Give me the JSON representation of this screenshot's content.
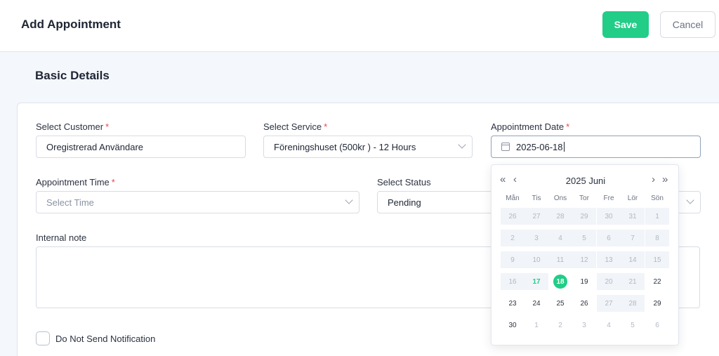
{
  "header": {
    "title": "Add Appointment",
    "save_label": "Save",
    "cancel_label": "Cancel"
  },
  "section": {
    "title": "Basic Details"
  },
  "form": {
    "customer": {
      "label": "Select Customer",
      "required": "*",
      "value": "Oregistrerad Användare"
    },
    "service": {
      "label": "Select Service",
      "required": "*",
      "value": "Föreningshuset (500kr ) - 12 Hours"
    },
    "date": {
      "label": "Appointment Date",
      "required": "*",
      "value": "2025-06-18"
    },
    "time": {
      "label": "Appointment Time",
      "required": "*",
      "placeholder": "Select Time"
    },
    "status": {
      "label": "Select Status",
      "value": "Pending"
    },
    "note": {
      "label": "Internal note"
    },
    "notify": {
      "label": "Do Not Send Notification",
      "checked": false
    }
  },
  "calendar": {
    "title": "2025 Juni",
    "prev_year": "«",
    "prev_month": "‹",
    "next_month": "›",
    "next_year": "»",
    "weekdays": [
      "Mån",
      "Tis",
      "Ons",
      "Tor",
      "Fre",
      "Lör",
      "Sön"
    ],
    "weeks": [
      [
        "26",
        "27",
        "28",
        "29",
        "30",
        "31",
        "1"
      ],
      [
        "2",
        "3",
        "4",
        "5",
        "6",
        "7",
        "8"
      ],
      [
        "9",
        "10",
        "11",
        "12",
        "13",
        "14",
        "15"
      ],
      [
        "16",
        "17",
        "18",
        "19",
        "20",
        "21",
        "22"
      ],
      [
        "23",
        "24",
        "25",
        "26",
        "27",
        "28",
        "29"
      ],
      [
        "30",
        "1",
        "2",
        "3",
        "4",
        "5",
        "6"
      ]
    ],
    "states": [
      [
        "disabled",
        "disabled",
        "disabled",
        "disabled",
        "disabled",
        "disabled",
        "disabled"
      ],
      [
        "disabled",
        "disabled",
        "disabled",
        "disabled",
        "disabled",
        "disabled",
        "disabled"
      ],
      [
        "disabled",
        "disabled",
        "disabled",
        "disabled",
        "disabled",
        "disabled",
        "disabled"
      ],
      [
        "disabled",
        "today",
        "selected",
        "normal",
        "disabled",
        "disabled",
        "normal"
      ],
      [
        "normal",
        "normal",
        "normal",
        "normal",
        "disabled",
        "disabled",
        "normal"
      ],
      [
        "normal",
        "other",
        "other",
        "other",
        "other",
        "other",
        "other"
      ]
    ],
    "accent": "#22cd87"
  }
}
